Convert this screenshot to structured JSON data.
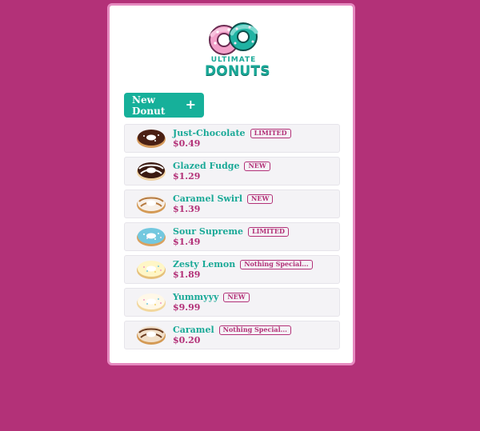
{
  "brand": {
    "top_text": "ULTIMATE",
    "bottom_text": "DONUTS"
  },
  "toolbar": {
    "new_donut_label": "New Donut",
    "new_donut_icon": "plus-icon"
  },
  "colors": {
    "background": "#b33178",
    "panel_border": "#e68ac0",
    "accent_teal": "#16b09a",
    "item_name": "#1aa997",
    "price": "#b33178"
  },
  "items": [
    {
      "name": "Just-Chocolate",
      "badge": "LIMITED",
      "price": "$0.49",
      "icon": "chocolate-donut-icon"
    },
    {
      "name": "Glazed Fudge",
      "badge": "NEW",
      "price": "$1.29",
      "icon": "fudge-drizzle-donut-icon"
    },
    {
      "name": "Caramel Swirl",
      "badge": "NEW",
      "price": "$1.39",
      "icon": "caramel-swirl-donut-icon"
    },
    {
      "name": "Sour Supreme",
      "badge": "LIMITED",
      "price": "$1.49",
      "icon": "sour-supreme-donut-icon"
    },
    {
      "name": "Zesty Lemon",
      "badge": "Nothing Special...",
      "price": "$1.89",
      "icon": "zesty-lemon-donut-icon"
    },
    {
      "name": "Yummyyy",
      "badge": "NEW",
      "price": "$9.99",
      "icon": "yummyyy-donut-icon"
    },
    {
      "name": "Caramel",
      "badge": "Nothing Special...",
      "price": "$0.20",
      "icon": "caramel-donut-icon"
    }
  ]
}
